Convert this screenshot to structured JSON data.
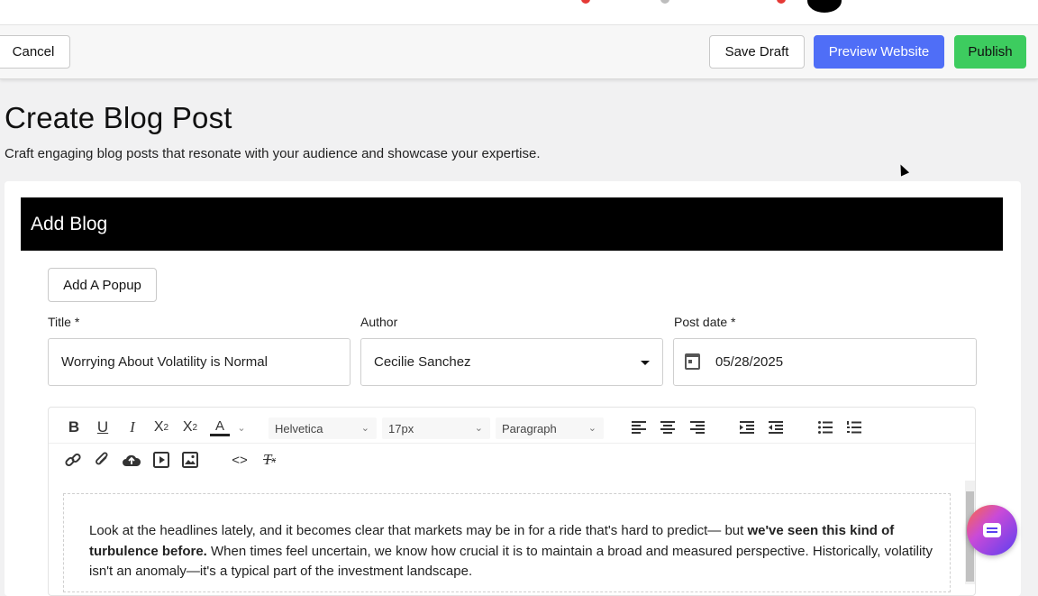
{
  "top_actions": {
    "cancel_label": "Cancel",
    "save_draft_label": "Save Draft",
    "preview_label": "Preview Website",
    "publish_label": "Publish"
  },
  "page": {
    "title": "Create Blog Post",
    "subtitle": "Craft engaging blog posts that resonate with your audience and showcase your expertise."
  },
  "card": {
    "header": "Add Blog",
    "add_popup_label": "Add A Popup"
  },
  "fields": {
    "title_label": "Title *",
    "title_value": "Worrying About Volatility is Normal",
    "author_label": "Author",
    "author_value": "Cecilie Sanchez",
    "date_label": "Post date *",
    "date_value": "05/28/2025"
  },
  "toolbar": {
    "font_family": "Helvetica",
    "font_size": "17px",
    "block_format": "Paragraph",
    "icons_row1": [
      "bold-icon",
      "underline-icon",
      "italic-icon",
      "subscript-icon",
      "superscript-icon",
      "text-color-icon",
      "align-left-icon",
      "align-center-icon",
      "align-right-icon",
      "indent-icon",
      "outdent-icon",
      "bulleted-list-icon",
      "numbered-list-icon"
    ],
    "icons_row2": [
      "link-icon",
      "attachment-icon",
      "cloud-upload-icon",
      "video-icon",
      "image-icon",
      "code-icon",
      "clear-format-icon"
    ]
  },
  "editor": {
    "line1_prefix": "Look at the headlines lately, and it becomes clear that markets may be in for a ride that's hard to predict— but ",
    "line1_bold": "we've seen this kind of turbulence before.",
    "line1_suffix": " When times feel uncertain, we know how crucial it is to maintain a broad and measured perspective.",
    "line2": "Historically, volatility isn't an anomaly—it's a typical part of the investment landscape."
  },
  "colors": {
    "preview_button": "#4f6ef7",
    "publish_button": "#3dcc5f",
    "header_bar": "#000000"
  }
}
